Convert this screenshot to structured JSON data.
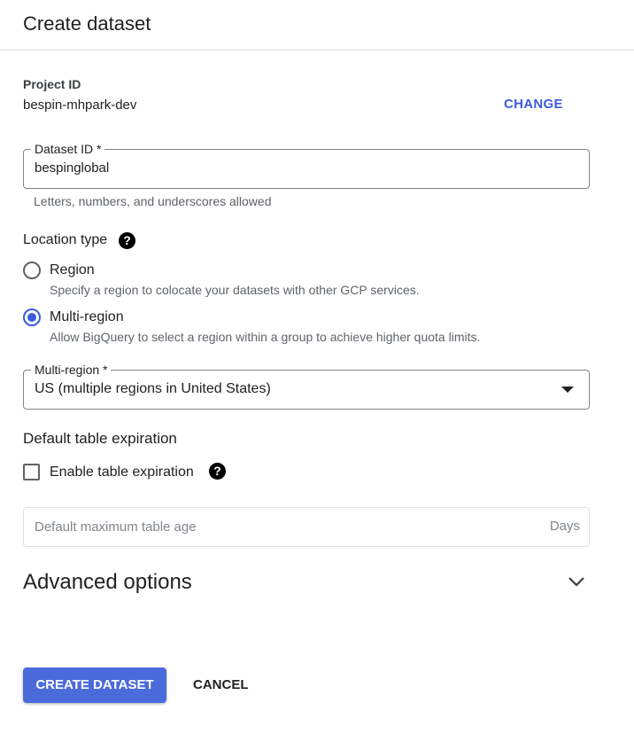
{
  "header": {
    "title": "Create dataset"
  },
  "project": {
    "label": "Project ID",
    "value": "bespin-mhpark-dev",
    "change_label": "CHANGE"
  },
  "dataset_id": {
    "label": "Dataset ID *",
    "value": "bespinglobal",
    "helper": "Letters, numbers, and underscores allowed"
  },
  "location": {
    "title": "Location type",
    "help_icon": "?",
    "options": [
      {
        "label": "Region",
        "description": "Specify a region to colocate your datasets with other GCP services.",
        "checked": false
      },
      {
        "label": "Multi-region",
        "description": "Allow BigQuery to select a region within a group to achieve higher quota limits.",
        "checked": true
      }
    ]
  },
  "multi_region": {
    "label": "Multi-region *",
    "selected": "US (multiple regions in United States)"
  },
  "expiration": {
    "title": "Default table expiration",
    "checkbox_label": "Enable table expiration",
    "checked": false,
    "help_icon": "?",
    "age_placeholder": "Default maximum table age",
    "age_suffix": "Days"
  },
  "advanced": {
    "title": "Advanced options"
  },
  "actions": {
    "create_label": "CREATE DATASET",
    "cancel_label": "CANCEL"
  },
  "colors": {
    "accent": "#3b5bdb",
    "primary_button": "#4b6bdb"
  }
}
